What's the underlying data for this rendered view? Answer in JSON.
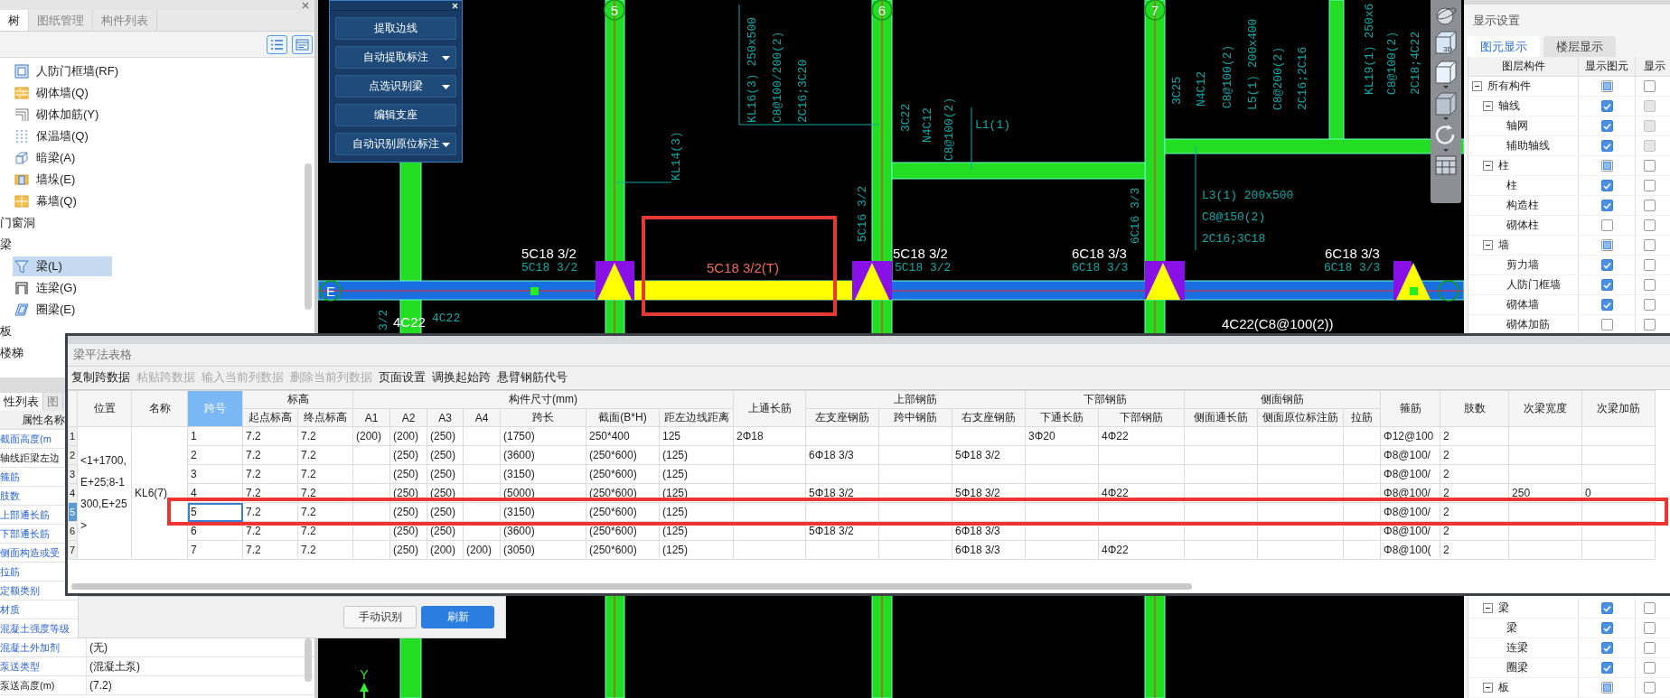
{
  "left_panel": {
    "tabs": [
      {
        "label": "树",
        "selected": true
      },
      {
        "label": "图纸管理",
        "selected": false
      },
      {
        "label": "构件列表",
        "selected": false
      }
    ],
    "tree": [
      {
        "kind": "item",
        "label": "人防门框墙(RF)",
        "selected": false
      },
      {
        "kind": "item",
        "label": "砌体墙(Q)",
        "selected": false
      },
      {
        "kind": "item",
        "label": "砌体加筋(Y)",
        "selected": false
      },
      {
        "kind": "item",
        "label": "保温墙(Q)",
        "selected": false
      },
      {
        "kind": "item",
        "label": "暗梁(A)",
        "selected": false
      },
      {
        "kind": "item",
        "label": "墙垛(E)",
        "selected": false
      },
      {
        "kind": "item",
        "label": "幕墙(Q)",
        "selected": false
      },
      {
        "kind": "group",
        "label": "门窗洞"
      },
      {
        "kind": "group",
        "label": "梁"
      },
      {
        "kind": "item",
        "label": "梁(L)",
        "selected": true
      },
      {
        "kind": "item",
        "label": "连梁(G)",
        "selected": false
      },
      {
        "kind": "item",
        "label": "圈梁(E)",
        "selected": false
      },
      {
        "kind": "group",
        "label": "板"
      },
      {
        "kind": "group",
        "label": "楼梯"
      }
    ]
  },
  "properties": {
    "tabs": [
      {
        "label": "性列表",
        "selected": true
      },
      {
        "label": "图",
        "selected": false
      }
    ],
    "header": "属性名称",
    "rows": [
      {
        "name": "截面高度(m",
        "public": true
      },
      {
        "name": "轴线距梁左边",
        "public": false
      },
      {
        "name": "箍筋",
        "public": true
      },
      {
        "name": "肢数",
        "public": true
      },
      {
        "name": "上部通长筋",
        "public": true
      },
      {
        "name": "下部通长筋",
        "public": true
      },
      {
        "name": "侧面构造或受",
        "public": true
      },
      {
        "name": "拉筋",
        "public": true
      },
      {
        "name": "定额类别",
        "public": true
      },
      {
        "name": "材质",
        "public": true
      },
      {
        "name": "混凝土强度等级",
        "public": true
      },
      {
        "name": "混凝土外加剂",
        "public": true,
        "value": "(无)"
      },
      {
        "name": "泵送类型",
        "public": true,
        "value": "(混凝土泵)"
      },
      {
        "name": "泵送高度(m)",
        "public": false,
        "value": "(7.2)"
      }
    ]
  },
  "recognition_toolbar": {
    "buttons": [
      {
        "label": "提取边线",
        "has_menu": false
      },
      {
        "label": "自动提取标注",
        "has_menu": true
      },
      {
        "label": "点选识别梁",
        "has_menu": true
      },
      {
        "label": "编辑支座",
        "has_menu": false
      },
      {
        "label": "自动识别原位标注",
        "has_menu": true
      }
    ]
  },
  "canvas": {
    "axes": [
      "5",
      "6",
      "7"
    ],
    "beam_axis": "E",
    "drawing_texts": [
      "KL16(3) 250x500",
      "C8@100/200(2)",
      "2C16;3C20",
      "KL14(3)",
      "3C22",
      "N4C12",
      "C8@100(2)",
      "L1(1)",
      "3C25",
      "N4C12",
      "C8@100(2)",
      "L5(1) 200x400",
      "C8@200(2)",
      "2C16;2C16",
      "KL19(1) 250x6",
      "C8@100(2)",
      "2C18;4C22",
      "L3(1) 200x500",
      "C8@150(2)",
      "2C16;3C18",
      "5C16 3/2",
      "6C16 3/3",
      "5C18 3/2",
      "5C18 3/2",
      "6C18 3/3",
      "6C18 3/3",
      "4C22",
      "3/2"
    ],
    "recognized_labels": [
      "5C18 3/2",
      "5C18 3/2",
      "6C18 3/3",
      "6C18 3/3",
      "4C22",
      "4C22(C8@100(2))"
    ],
    "selected_label": "5C18 3/2(T)",
    "axis_marker": "Y"
  },
  "view_toolbar": {
    "badge": "3D"
  },
  "display_settings": {
    "title": "显示设置",
    "tabs": [
      {
        "label": "图元显示",
        "selected": true
      },
      {
        "label": "楼层显示",
        "selected": false
      }
    ],
    "columns": [
      "图层构件",
      "显示图元",
      "显示"
    ],
    "layers": [
      {
        "label": "所有构件",
        "checked": false,
        "partial": true,
        "expanded": true,
        "name_checked": false,
        "name_disabled": false,
        "children": [
          {
            "label": "轴线",
            "checked": true,
            "partial": false,
            "expanded": true,
            "name_checked": false,
            "name_disabled": true,
            "children": [
              {
                "label": "轴网",
                "checked": true,
                "partial": false,
                "name_checked": false,
                "name_disabled": true
              },
              {
                "label": "辅助轴线",
                "checked": true,
                "partial": false,
                "name_checked": false,
                "name_disabled": true
              }
            ]
          },
          {
            "label": "柱",
            "checked": false,
            "partial": true,
            "expanded": true,
            "name_checked": false,
            "name_disabled": false,
            "children": [
              {
                "label": "柱",
                "checked": true,
                "partial": false,
                "name_checked": false,
                "name_disabled": false
              },
              {
                "label": "构造柱",
                "checked": true,
                "partial": false,
                "name_checked": false,
                "name_disabled": false
              },
              {
                "label": "砌体柱",
                "checked": false,
                "partial": false,
                "name_checked": false,
                "name_disabled": false
              }
            ]
          },
          {
            "label": "墙",
            "checked": false,
            "partial": true,
            "expanded": true,
            "name_checked": false,
            "name_disabled": false,
            "children": [
              {
                "label": "剪力墙",
                "checked": true,
                "partial": false,
                "name_checked": false,
                "name_disabled": false
              },
              {
                "label": "人防门框墙",
                "checked": true,
                "partial": false,
                "name_checked": false,
                "name_disabled": false
              },
              {
                "label": "砌体墙",
                "checked": true,
                "partial": false,
                "name_checked": false,
                "name_disabled": false
              },
              {
                "label": "砌体加筋",
                "checked": false,
                "partial": false,
                "name_checked": false,
                "name_disabled": false
              }
            ]
          },
          {
            "label": "梁",
            "checked": true,
            "partial": false,
            "expanded": true,
            "name_checked": false,
            "name_disabled": false,
            "children": [
              {
                "label": "梁",
                "checked": true,
                "partial": false,
                "name_checked": false,
                "name_disabled": false
              },
              {
                "label": "连梁",
                "checked": true,
                "partial": false,
                "name_checked": false,
                "name_disabled": false
              },
              {
                "label": "圈梁",
                "checked": true,
                "partial": false,
                "name_checked": false,
                "name_disabled": false
              }
            ]
          },
          {
            "label": "板",
            "checked": false,
            "partial": true,
            "expanded": true,
            "name_checked": false,
            "name_disabled": false
          }
        ]
      }
    ]
  },
  "beam_table": {
    "title": "梁平法表格",
    "toolbar": [
      {
        "label": "复制跨数据",
        "disabled": false
      },
      {
        "label": "粘贴跨数据",
        "disabled": true
      },
      {
        "label": "输入当前列数据",
        "disabled": true
      },
      {
        "label": "删除当前列数据",
        "disabled": true
      },
      {
        "label": "页面设置",
        "disabled": false
      },
      {
        "label": "调换起始跨",
        "disabled": false
      },
      {
        "label": "悬臂钢筋代号",
        "disabled": false
      }
    ],
    "location_header": "位置",
    "name_header": "名称",
    "columns": [
      {
        "label": "跨号",
        "selected": true
      },
      {
        "label": "标高",
        "selected": false,
        "colspan": 2,
        "sub": [
          "起点标高",
          "终点标高"
        ]
      },
      {
        "label": "构件尺寸(mm)",
        "selected": false,
        "colspan": 7,
        "sub": [
          "A1",
          "A2",
          "A3",
          "A4",
          "跨长",
          "截面(B*H)",
          "距左边线距离"
        ]
      },
      {
        "label": "上通长筋",
        "selected": false
      },
      {
        "label": "上部钢筋",
        "selected": false,
        "colspan": 3,
        "sub": [
          "左支座钢筋",
          "跨中钢筋",
          "右支座钢筋"
        ]
      },
      {
        "label": "下部钢筋",
        "selected": false,
        "colspan": 2,
        "sub": [
          "下通长筋",
          "下部钢筋"
        ]
      },
      {
        "label": "侧面钢筋",
        "selected": false,
        "colspan": 3,
        "sub": [
          "侧面通长筋",
          "侧面原位标注筋",
          "拉筋"
        ]
      },
      {
        "label": "箍筋",
        "selected": false
      },
      {
        "label": "肢数",
        "selected": false
      },
      {
        "label": "次梁宽度",
        "selected": false
      },
      {
        "label": "次梁加筋",
        "selected": false
      }
    ],
    "location": "<1+1700,E+25;8-1300,E+25>",
    "name": "KL6(7)",
    "rows": [
      {
        "num": "1",
        "selected": false,
        "cells": [
          "1",
          "7.2",
          "7.2",
          "(200)",
          "(200)",
          "(250)",
          null,
          "(1750)",
          "250*400",
          "125",
          "2Φ18",
          null,
          null,
          null,
          "3Φ20",
          "4Φ22",
          null,
          null,
          null,
          "Φ12@100",
          "2",
          null,
          null
        ]
      },
      {
        "num": "2",
        "selected": false,
        "cells": [
          "2",
          "7.2",
          "7.2",
          null,
          "(250)",
          "(250)",
          null,
          "(3600)",
          "(250*600)",
          "(125)",
          null,
          "6Φ18 3/3",
          null,
          "5Φ18 3/2",
          null,
          null,
          null,
          null,
          null,
          "Φ8@100/",
          "2",
          null,
          null
        ]
      },
      {
        "num": "3",
        "selected": false,
        "cells": [
          "3",
          "7.2",
          "7.2",
          null,
          "(250)",
          "(250)",
          null,
          "(3150)",
          "(250*600)",
          "(125)",
          null,
          null,
          null,
          null,
          null,
          null,
          null,
          null,
          null,
          "Φ8@100/",
          "2",
          null,
          null
        ]
      },
      {
        "num": "4",
        "selected": false,
        "cells": [
          "4",
          "7.2",
          "7.2",
          null,
          "(250)",
          "(250)",
          null,
          "(5000)",
          "(250*600)",
          "(125)",
          null,
          "5Φ18 3/2",
          null,
          "5Φ18 3/2",
          null,
          "4Φ22",
          null,
          null,
          null,
          "Φ8@100/",
          "2",
          "250",
          "0"
        ]
      },
      {
        "num": "5",
        "selected": true,
        "cells": [
          "5",
          "7.2",
          "7.2",
          null,
          "(250)",
          "(250)",
          null,
          "(3150)",
          "(250*600)",
          "(125)",
          null,
          null,
          null,
          null,
          null,
          null,
          null,
          null,
          null,
          "Φ8@100/",
          "2",
          null,
          null
        ]
      },
      {
        "num": "6",
        "selected": false,
        "cells": [
          "6",
          "7.2",
          "7.2",
          null,
          "(250)",
          "(250)",
          null,
          "(3600)",
          "(250*600)",
          "(125)",
          null,
          "5Φ18 3/2",
          null,
          "6Φ18 3/3",
          null,
          null,
          null,
          null,
          null,
          "Φ8@100/",
          "2",
          null,
          null
        ]
      },
      {
        "num": "7",
        "selected": false,
        "cells": [
          "7",
          "7.2",
          "7.2",
          null,
          "(250)",
          "(200)",
          "(200)",
          "(3050)",
          "(250*600)",
          "(125)",
          null,
          null,
          null,
          "6Φ18 3/3",
          null,
          "4Φ22",
          null,
          null,
          null,
          "Φ8@100(",
          "2",
          null,
          null
        ]
      }
    ]
  },
  "actions": [
    {
      "label": "手动识别",
      "primary": false
    },
    {
      "label": "刷新",
      "primary": true
    }
  ]
}
